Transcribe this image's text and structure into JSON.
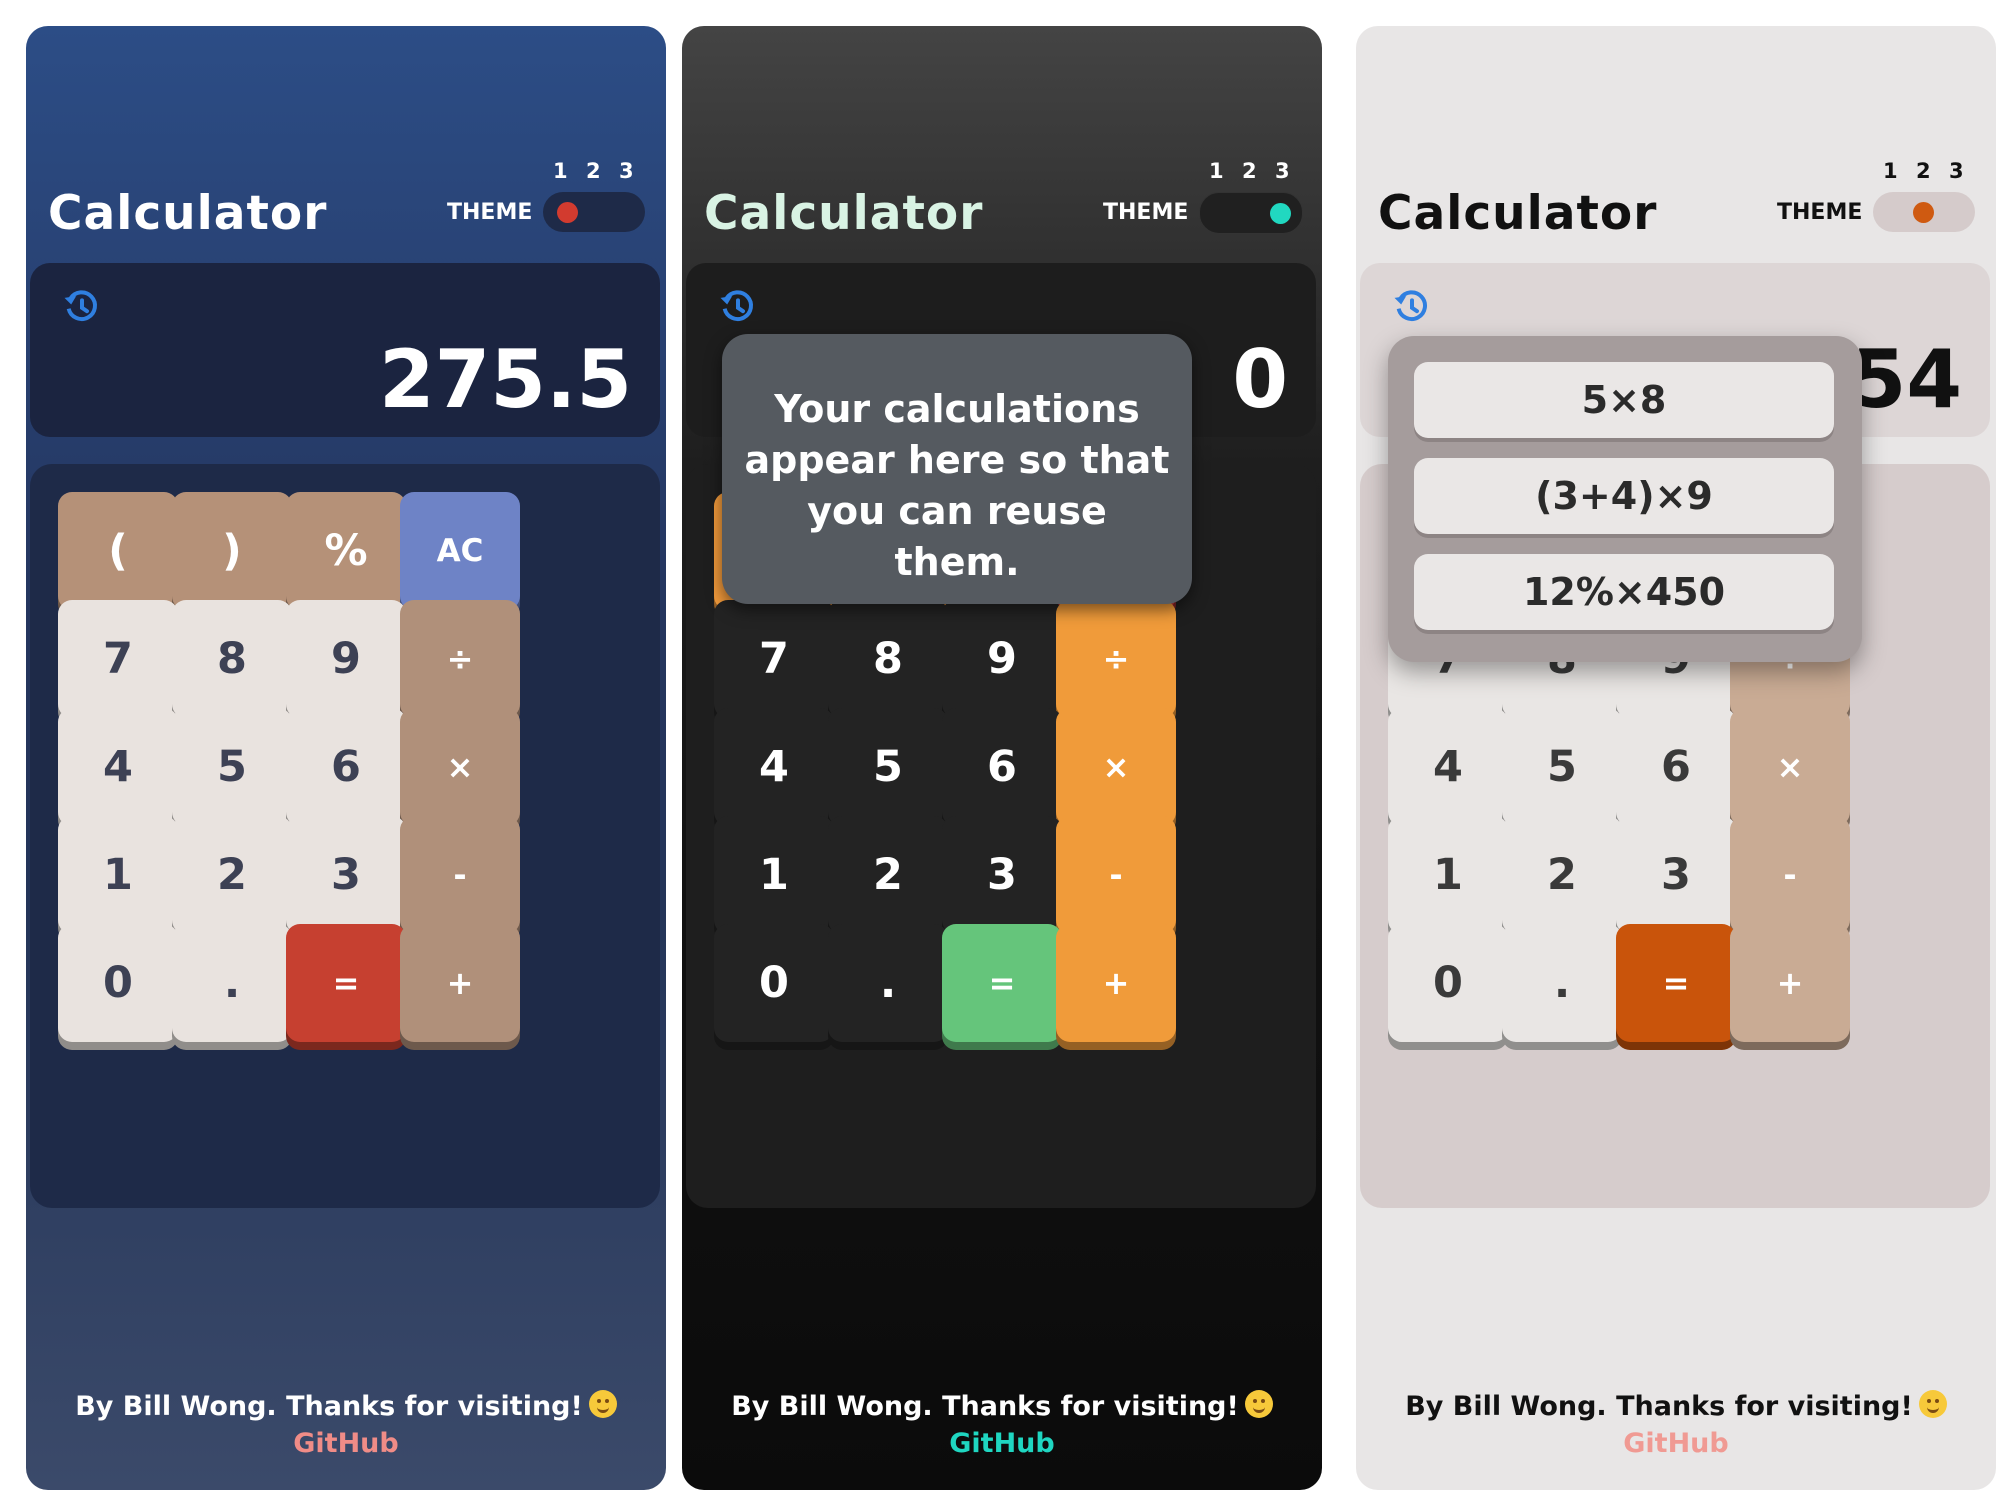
{
  "app_title": "Calculator",
  "theme_label": "THEME",
  "theme_numbers": [
    "1",
    "2",
    "3"
  ],
  "footer": {
    "text": "By Bill Wong. Thanks for visiting!",
    "link": "GitHub"
  },
  "keys": [
    [
      "(",
      ")",
      "%",
      "AC"
    ],
    [
      "7",
      "8",
      "9",
      "÷"
    ],
    [
      "4",
      "5",
      "6",
      "×"
    ],
    [
      "1",
      "2",
      "3",
      "-"
    ],
    [
      "0",
      ".",
      "=",
      "+"
    ]
  ],
  "panels": [
    {
      "theme": "1",
      "display": "275.5",
      "colors": {
        "paren": "#b59178",
        "number": "#e9e3df",
        "operator": "#b0907a",
        "ac": "#6e83c6",
        "equals": "#c64030",
        "number_text": "#3d4154",
        "light_text": "#ffffff"
      }
    },
    {
      "theme": "2",
      "display": "0",
      "tooltip": "Your calculations appear here so that you can reuse them.",
      "colors": {
        "paren": "#f0993b",
        "number": "#232323",
        "operator": "#f09b3a",
        "ac": "#d13a3f",
        "equals": "#65c57b",
        "number_text": "#ffffff",
        "light_text": "#ffffff"
      }
    },
    {
      "theme": "3",
      "display": "54",
      "history": [
        "5×8",
        "(3+4)×9",
        "12%×450"
      ],
      "colors": {
        "paren": "#c9ad97",
        "number": "#e9e6e4",
        "operator": "#c9ab94",
        "ac": "#2f7c80",
        "equals": "#c9540b",
        "number_text": "#3a3a3a",
        "light_text": "#ffffff"
      }
    }
  ]
}
